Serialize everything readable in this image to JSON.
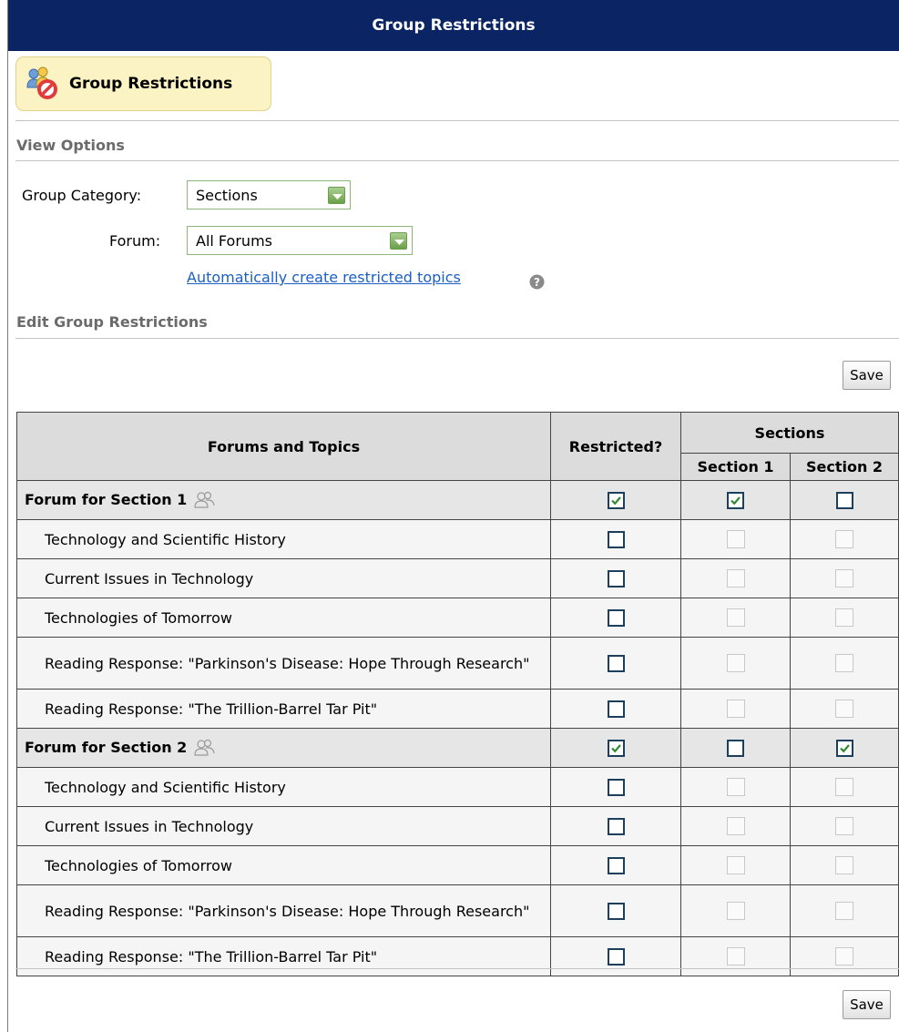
{
  "window": {
    "title": "Group Restrictions"
  },
  "toolbar": {
    "group_restrictions_label": "Group Restrictions"
  },
  "view_options": {
    "heading": "View Options",
    "group_category_label": "Group Category:",
    "group_category_value": "Sections",
    "forum_label": "Forum:",
    "forum_value": "All Forums",
    "auto_create_link": "Automatically create restricted topics"
  },
  "edit": {
    "heading": "Edit Group Restrictions",
    "save_label": "Save"
  },
  "table": {
    "col_forums": "Forums and Topics",
    "col_restricted": "Restricted?",
    "col_group": "Sections",
    "col_sec1": "Section 1",
    "col_sec2": "Section 2",
    "rows": [
      {
        "type": "forum",
        "name": "Forum for Section 1",
        "restricted": true,
        "sec1": true,
        "sec2": false
      },
      {
        "type": "topic",
        "name": "Technology and Scientific History",
        "restricted": false
      },
      {
        "type": "topic",
        "name": "Current Issues in Technology",
        "restricted": false
      },
      {
        "type": "topic",
        "name": "Technologies of Tomorrow",
        "restricted": false
      },
      {
        "type": "topic",
        "name": "Reading Response: \"Parkinson's Disease: Hope Through Research\"",
        "restricted": false
      },
      {
        "type": "topic",
        "name": "Reading Response: \"The Trillion-Barrel Tar Pit\"",
        "restricted": false
      },
      {
        "type": "forum",
        "name": "Forum for Section 2",
        "restricted": true,
        "sec1": false,
        "sec2": true
      },
      {
        "type": "topic",
        "name": "Technology and Scientific History",
        "restricted": false
      },
      {
        "type": "topic",
        "name": "Current Issues in Technology",
        "restricted": false
      },
      {
        "type": "topic",
        "name": "Technologies of Tomorrow",
        "restricted": false
      },
      {
        "type": "topic",
        "name": "Reading Response: \"Parkinson's Disease: Hope Through Research\"",
        "restricted": false
      },
      {
        "type": "topic",
        "name": "Reading Response: \"The Trillion-Barrel Tar Pit\"",
        "restricted": false
      }
    ]
  },
  "colors": {
    "titlebar": "#0a2464",
    "link": "#1b5fc4",
    "check": "#2f8a2f"
  },
  "icons": {
    "toolbar": "group-restrictions-icon",
    "help": "help-icon",
    "group": "group-icon"
  }
}
